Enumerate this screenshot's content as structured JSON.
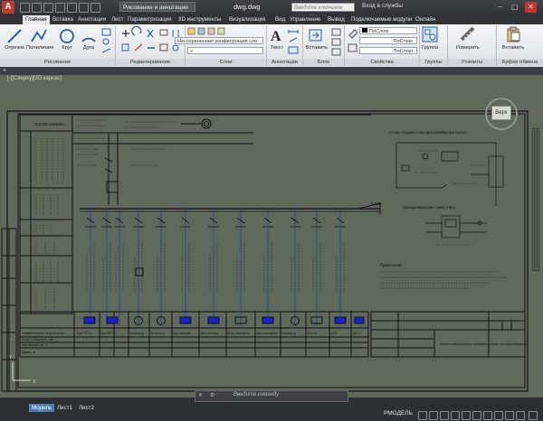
{
  "titlebar": {
    "workspace": "Рисование и аннотации",
    "document_title": "dwg.dwg",
    "search_placeholder": "Введите ключевое слово/фразу",
    "signin": "Вход в службы"
  },
  "ribbon_tabs": [
    "Главная",
    "Вставка",
    "Аннотации",
    "Лист",
    "Параметризация",
    "3D инструменты",
    "Визуализация",
    "Вид",
    "Управление",
    "Вывод",
    "Подключаемые модули",
    "Онлайн"
  ],
  "ribbon": {
    "draw_tools": [
      "Отрезок",
      "Полилиния",
      "Круг",
      "Дуга"
    ],
    "layer_combo": "Несохраненная конфигурация сло",
    "annotation_tool": "Текст",
    "block_tool": "Вставить",
    "properties": {
      "color": "ПоСлою",
      "linetype": "ПоСлою",
      "lineweight": "ПоСлою"
    },
    "groups_tool": "Группа",
    "utilities_tool": "Измерить",
    "clipboard_tool": "Вставить",
    "panels": [
      "Рисование",
      "Редактирование",
      "Слои",
      "Аннотации",
      "Блок",
      "Свойства",
      "Группы",
      "Утилиты",
      "Буфер обмена"
    ]
  },
  "viewport": {
    "label": "[-][Сверху][2D каркас]",
    "viewcube": "Верх"
  },
  "drawing": {
    "table_header": "ЯЗЛИ6 ОВЛ6К6",
    "bus_label": "0.4кВ",
    "schema_title_1": "Схема подключения фотоячейки при пульте",
    "schema_title_2": "Принципиальная схема учёта",
    "notes_title": "Примечания:",
    "stamp_text": "Схема электрическая принципиальная электроосвещения",
    "row_labels": [
      "Наименование потребителя",
      "Устан. мощность, кВт",
      "Расчётный ток, А",
      "Длина, м"
    ],
    "consumers": [
      "Щит ЯРП-1",
      "Щит ЯРП-2",
      "Прожектор",
      "Прожектор",
      "Щит рекламы",
      "Щит рекламы",
      "Ввод освещения",
      "Щит освещения",
      "Прожектор",
      "Розетки",
      "ЦЛК",
      "ЩУЭ"
    ]
  },
  "cmdline": {
    "placeholder": "Введите команду"
  },
  "layout_tabs": [
    "Модель",
    "Лист1",
    "Лист2"
  ],
  "status": {
    "mode": "РМОДЕЛЬ"
  }
}
